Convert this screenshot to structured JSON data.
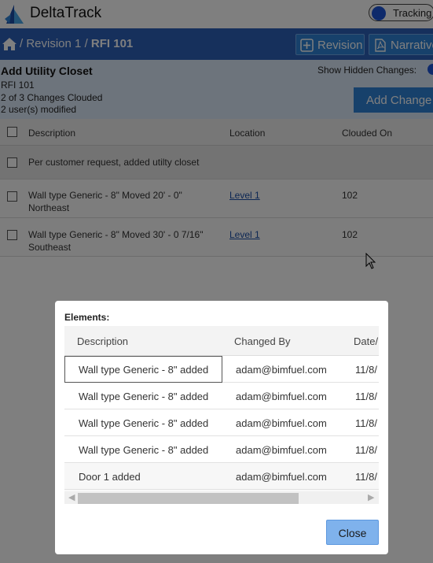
{
  "app": {
    "title": "DeltaTrack",
    "tracking_label": "Tracking",
    "accent": "#2d61b8",
    "button_color": "#2f82d6"
  },
  "breadcrumb": {
    "home_icon": "home-icon",
    "sep1": "/",
    "revision": "Revision 1",
    "sep2": "/",
    "current": "RFI 101"
  },
  "toolbar": {
    "revision_label": "Revision",
    "narrative_label": "Narrative"
  },
  "info": {
    "title": "Add Utility Closet",
    "rfi": "RFI 101",
    "clouded_summary": "2 of 3 Changes Clouded",
    "users_modified": "2 user(s) modified",
    "show_hidden_label": "Show Hidden Changes:",
    "add_change_label": "Add Change"
  },
  "grid": {
    "columns": [
      "Description",
      "Location",
      "Clouded On"
    ],
    "group_row": "Per customer request, added utilty closet",
    "rows": [
      {
        "desc1": "Wall type Generic - 8\" Moved 20' - 0\"",
        "desc2": "Northeast",
        "location": "Level 1",
        "clouded_on": "102"
      },
      {
        "desc1": "Wall type Generic - 8\" Moved 30' - 0 7/16\"",
        "desc2": "Southeast",
        "location": "Level 1",
        "clouded_on": "102"
      }
    ]
  },
  "dialog": {
    "title": "Elements:",
    "columns": [
      "Description",
      "Changed By",
      "Date/"
    ],
    "rows": [
      {
        "description": "Wall type Generic - 8\" added",
        "changed_by": "adam@bimfuel.com",
        "date": "11/8/"
      },
      {
        "description": "Wall type Generic - 8\" added",
        "changed_by": "adam@bimfuel.com",
        "date": "11/8/"
      },
      {
        "description": "Wall type Generic - 8\" added",
        "changed_by": "adam@bimfuel.com",
        "date": "11/8/"
      },
      {
        "description": "Wall type Generic - 8\" added",
        "changed_by": "adam@bimfuel.com",
        "date": "11/8/"
      },
      {
        "description": "Door 1 added",
        "changed_by": "adam@bimfuel.com",
        "date": "11/8/"
      }
    ],
    "close_label": "Close"
  }
}
